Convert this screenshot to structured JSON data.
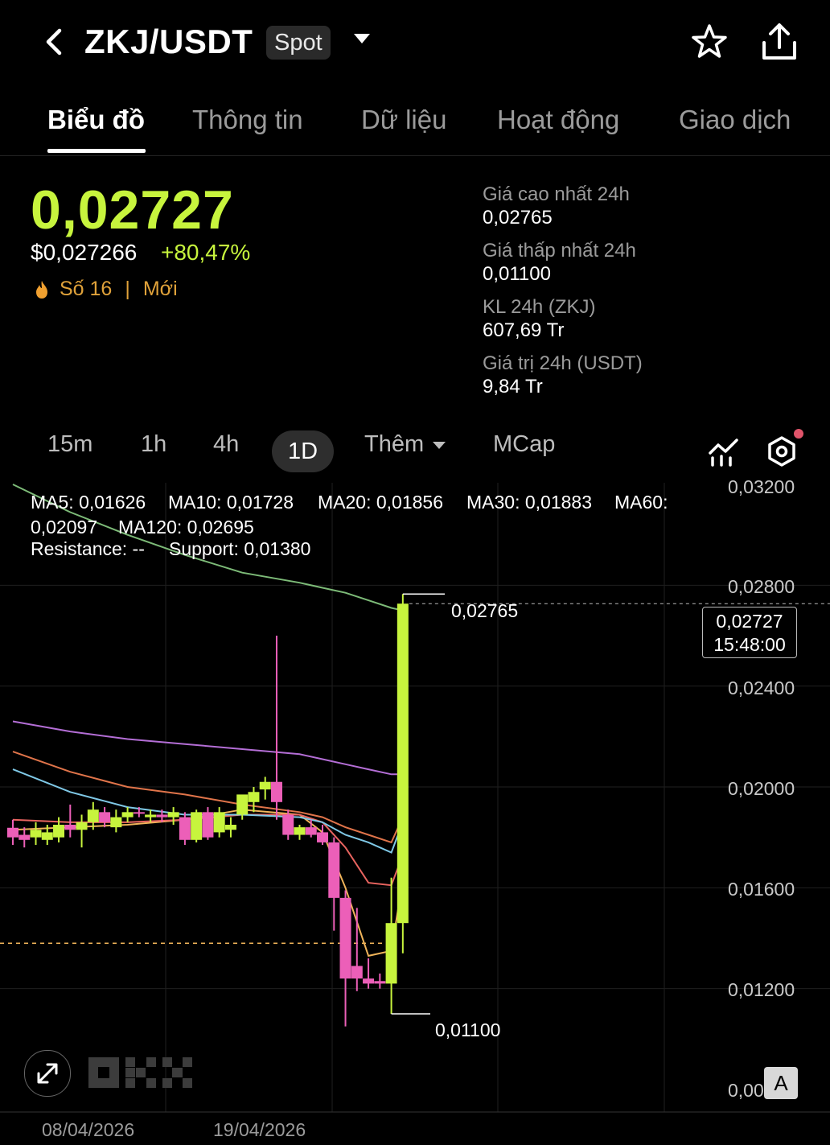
{
  "header": {
    "title": "ZKJ/USDT",
    "badge": "Spot"
  },
  "tabs": [
    {
      "label": "Biểu đồ",
      "active": true
    },
    {
      "label": "Thông tin"
    },
    {
      "label": "Dữ liệu"
    },
    {
      "label": "Hoạt động"
    },
    {
      "label": "Giao dịch"
    }
  ],
  "ticker": {
    "price": "0,02727",
    "usd_price": "$0,027266",
    "change": "+80,47%",
    "rank": "Số 16",
    "rank_separator": "|",
    "tag": "Mới"
  },
  "stats": [
    {
      "label": "Giá cao nhất 24h",
      "value": "0,02765"
    },
    {
      "label": "Giá thấp nhất 24h",
      "value": "0,01100"
    },
    {
      "label": "KL 24h (ZKJ)",
      "value": "607,69 Tr"
    },
    {
      "label": "Giá trị 24h (USDT)",
      "value": "9,84 Tr"
    }
  ],
  "intervals": {
    "i15m": "15m",
    "i1h": "1h",
    "i4h": "4h",
    "i1d": "1D",
    "more": "Thêm",
    "mcap": "MCap",
    "selected": "1D"
  },
  "indicators": {
    "ma5": "MA5: 0,01626",
    "ma10": "MA10: 0,01728",
    "ma20": "MA20: 0,01856",
    "ma30": "MA30: 0,01883",
    "ma60": "MA60:",
    "ma60_value": "0,02097",
    "ma120": "MA120: 0,02695",
    "resistance": "Resistance: --",
    "support": "Support: 0,01380"
  },
  "colors": {
    "up": "#c7f43d",
    "down": "#ec5fb8",
    "ma5": "#f0b45a",
    "ma10": "#e8645f",
    "ma20": "#7fc8e6",
    "ma30": "#e0744a",
    "ma60": "#b46ed6",
    "ma120": "#7dbb78",
    "support": "#f0b45a"
  },
  "chart_data": {
    "type": "candlestick",
    "ylim": [
      0.008,
      0.032
    ],
    "y_ticks": [
      "0,03200",
      "0,02800",
      "0,02400",
      "0,02000",
      "0,01600",
      "0,01200",
      "0,00800"
    ],
    "x_ticks": [
      "08/04/2026",
      "19/04/2026"
    ],
    "high_label": "0,02765",
    "low_label": "0,01100",
    "last_price": "0,02727",
    "countdown": "15:48:00",
    "support": 0.0138,
    "candles": [
      {
        "o": 0.01838,
        "h": 0.0187,
        "l": 0.0177,
        "c": 0.018
      },
      {
        "o": 0.0181,
        "h": 0.0184,
        "l": 0.0176,
        "c": 0.0179
      },
      {
        "o": 0.018,
        "h": 0.0186,
        "l": 0.0177,
        "c": 0.0183
      },
      {
        "o": 0.0179,
        "h": 0.0185,
        "l": 0.0177,
        "c": 0.0182
      },
      {
        "o": 0.018,
        "h": 0.0188,
        "l": 0.0178,
        "c": 0.0185
      },
      {
        "o": 0.0185,
        "h": 0.0193,
        "l": 0.018,
        "c": 0.0183
      },
      {
        "o": 0.0183,
        "h": 0.0189,
        "l": 0.0176,
        "c": 0.0186
      },
      {
        "o": 0.0186,
        "h": 0.0194,
        "l": 0.0183,
        "c": 0.0191
      },
      {
        "o": 0.019,
        "h": 0.0192,
        "l": 0.0184,
        "c": 0.0186
      },
      {
        "o": 0.0184,
        "h": 0.0191,
        "l": 0.0182,
        "c": 0.0188
      },
      {
        "o": 0.0188,
        "h": 0.0192,
        "l": 0.0186,
        "c": 0.019
      },
      {
        "o": 0.019,
        "h": 0.0192,
        "l": 0.0188,
        "c": 0.01895
      },
      {
        "o": 0.0188,
        "h": 0.0191,
        "l": 0.0186,
        "c": 0.0189
      },
      {
        "o": 0.0189,
        "h": 0.0191,
        "l": 0.0186,
        "c": 0.0188
      },
      {
        "o": 0.0188,
        "h": 0.0192,
        "l": 0.0185,
        "c": 0.019
      },
      {
        "o": 0.0188,
        "h": 0.019,
        "l": 0.0177,
        "c": 0.0179
      },
      {
        "o": 0.0179,
        "h": 0.0191,
        "l": 0.0178,
        "c": 0.019
      },
      {
        "o": 0.019,
        "h": 0.0192,
        "l": 0.0179,
        "c": 0.018
      },
      {
        "o": 0.0182,
        "h": 0.0192,
        "l": 0.018,
        "c": 0.019
      },
      {
        "o": 0.0183,
        "h": 0.0188,
        "l": 0.018,
        "c": 0.0185
      },
      {
        "o": 0.0189,
        "h": 0.0196,
        "l": 0.0187,
        "c": 0.0197
      },
      {
        "o": 0.0194,
        "h": 0.02,
        "l": 0.019,
        "c": 0.0198
      },
      {
        "o": 0.0199,
        "h": 0.0204,
        "l": 0.0195,
        "c": 0.0202
      },
      {
        "o": 0.0202,
        "h": 0.026,
        "l": 0.0187,
        "c": 0.0194
      },
      {
        "o": 0.0189,
        "h": 0.0191,
        "l": 0.0179,
        "c": 0.0181
      },
      {
        "o": 0.0181,
        "h": 0.0185,
        "l": 0.0179,
        "c": 0.0184
      },
      {
        "o": 0.0184,
        "h": 0.0187,
        "l": 0.018,
        "c": 0.0181
      },
      {
        "o": 0.0182,
        "h": 0.0185,
        "l": 0.0177,
        "c": 0.0178
      },
      {
        "o": 0.0178,
        "h": 0.018,
        "l": 0.0143,
        "c": 0.0156
      },
      {
        "o": 0.0156,
        "h": 0.0159,
        "l": 0.0105,
        "c": 0.0124
      },
      {
        "o": 0.0129,
        "h": 0.0152,
        "l": 0.0119,
        "c": 0.0124
      },
      {
        "o": 0.0124,
        "h": 0.0132,
        "l": 0.012,
        "c": 0.0122
      },
      {
        "o": 0.0123,
        "h": 0.0126,
        "l": 0.012,
        "c": 0.0122
      },
      {
        "o": 0.0122,
        "h": 0.0164,
        "l": 0.011,
        "c": 0.0146
      },
      {
        "o": 0.0146,
        "h": 0.02765,
        "l": 0.0134,
        "c": 0.02727
      }
    ],
    "ma_series": [
      {
        "name": "MA5",
        "color": "#f0b45a",
        "x": [
          0,
          5,
          10,
          15,
          20,
          25,
          27,
          29,
          31,
          33,
          34
        ],
        "y": [
          0.0183,
          0.0184,
          0.0185,
          0.0187,
          0.0191,
          0.0189,
          0.0182,
          0.016,
          0.0133,
          0.0135,
          0.0163
        ]
      },
      {
        "name": "MA10",
        "color": "#e8645f",
        "x": [
          0,
          5,
          10,
          15,
          20,
          25,
          27,
          29,
          31,
          33,
          34
        ],
        "y": [
          0.0187,
          0.0186,
          0.0186,
          0.0187,
          0.0189,
          0.0189,
          0.0186,
          0.0176,
          0.0162,
          0.0161,
          0.0173
        ]
      },
      {
        "name": "MA20",
        "color": "#7fc8e6",
        "x": [
          0,
          5,
          10,
          15,
          20,
          25,
          27,
          29,
          31,
          33,
          34
        ],
        "y": [
          0.0207,
          0.0198,
          0.0192,
          0.0189,
          0.0189,
          0.0188,
          0.0186,
          0.0181,
          0.0178,
          0.0174,
          0.0186
        ]
      },
      {
        "name": "MA30",
        "color": "#e0744a",
        "x": [
          0,
          5,
          10,
          15,
          20,
          25,
          27,
          29,
          31,
          33,
          34
        ],
        "y": [
          0.0214,
          0.0206,
          0.02,
          0.0197,
          0.0193,
          0.019,
          0.0188,
          0.0184,
          0.0181,
          0.0178,
          0.0188
        ]
      },
      {
        "name": "MA60",
        "color": "#b46ed6",
        "x": [
          0,
          5,
          10,
          15,
          20,
          25,
          27,
          29,
          31,
          33,
          34
        ],
        "y": [
          0.0226,
          0.0222,
          0.0219,
          0.0217,
          0.0215,
          0.0213,
          0.0211,
          0.0209,
          0.0207,
          0.0205,
          0.0205
        ]
      },
      {
        "name": "MA120",
        "color": "#7dbb78",
        "x": [
          0,
          5,
          10,
          15,
          20,
          25,
          27,
          29,
          31,
          33,
          34
        ],
        "y": [
          0.032,
          0.0309,
          0.03,
          0.0292,
          0.0285,
          0.0281,
          0.0279,
          0.0277,
          0.0274,
          0.0271,
          0.027
        ]
      }
    ]
  }
}
